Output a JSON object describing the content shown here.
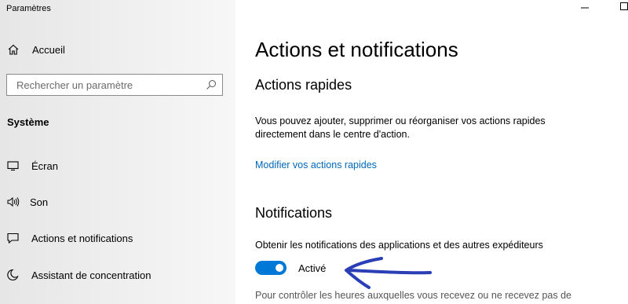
{
  "window": {
    "title": "Paramètres",
    "minimize_icon": "minimize-icon",
    "maximize_icon": "maximize-icon"
  },
  "sidebar": {
    "home_label": "Accueil",
    "search_placeholder": "Rechercher un paramètre",
    "section_title": "Système",
    "items": [
      {
        "label": "Écran",
        "icon": "display-icon"
      },
      {
        "label": "Son",
        "icon": "speaker-icon"
      },
      {
        "label": "Actions et notifications",
        "icon": "notification-icon"
      },
      {
        "label": "Assistant de concentration",
        "icon": "moon-icon"
      }
    ]
  },
  "main": {
    "page_title": "Actions et notifications",
    "quick_actions": {
      "heading": "Actions rapides",
      "description": "Vous pouvez ajouter, supprimer ou réorganiser vos actions rapides directement dans le centre d'action.",
      "link": "Modifier vos actions rapides"
    },
    "notifications": {
      "heading": "Notifications",
      "description": "Obtenir les notifications des applications et des autres expéditeurs",
      "toggle_state": "Activé",
      "toggle_on": true,
      "footer_text": "Pour contrôler les heures auxquelles vous recevez ou ne recevez pas de"
    }
  },
  "colors": {
    "accent": "#0078d7",
    "link": "#0067b8",
    "annotation": "#2a3fb5"
  }
}
